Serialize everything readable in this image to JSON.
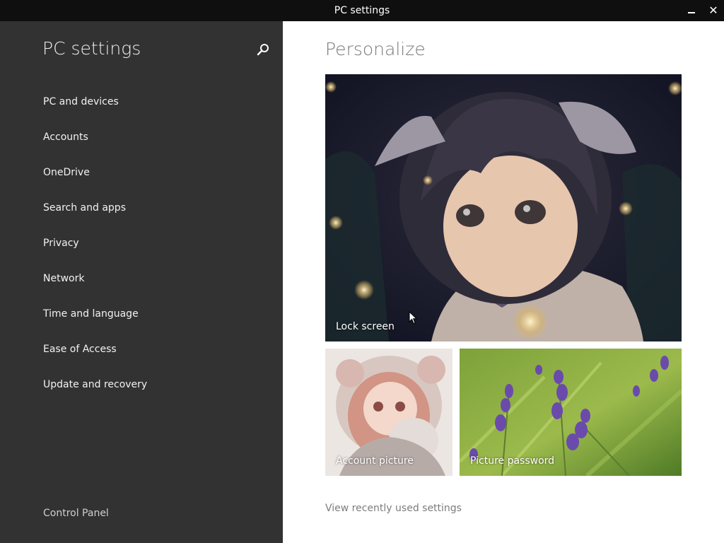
{
  "window": {
    "title": "PC settings",
    "minimize_glyph": "minimize-icon",
    "close_glyph": "✕"
  },
  "sidebar": {
    "title": "PC settings",
    "search_icon": "search-icon",
    "items": [
      {
        "label": "PC and devices"
      },
      {
        "label": "Accounts"
      },
      {
        "label": "OneDrive"
      },
      {
        "label": "Search and apps"
      },
      {
        "label": "Privacy"
      },
      {
        "label": "Network"
      },
      {
        "label": "Time and language"
      },
      {
        "label": "Ease of Access"
      },
      {
        "label": "Update and recovery"
      }
    ],
    "control_panel": "Control Panel"
  },
  "main": {
    "title": "Personalize",
    "tiles": {
      "lock_screen": {
        "label": "Lock screen"
      },
      "account_picture": {
        "label": "Account picture"
      },
      "picture_password": {
        "label": "Picture password"
      }
    },
    "recent_link": "View recently used settings"
  },
  "colors": {
    "titlebar": "#0f0f0f",
    "sidebar_bg": "#323232",
    "main_bg": "#ffffff",
    "heading_gray": "#7a7a7a",
    "link_gray": "#7d7d7d"
  }
}
